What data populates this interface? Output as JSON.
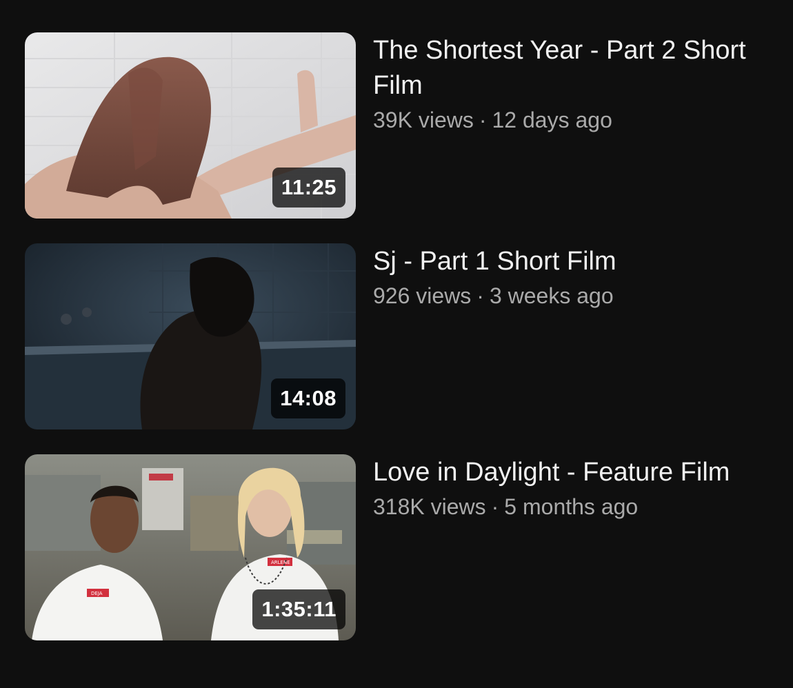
{
  "videos": [
    {
      "title": "The Shortest Year - Part 2 Short Film",
      "views": "39K views",
      "separator": "·",
      "age": "12 days ago",
      "duration": "11:25"
    },
    {
      "title": "Sj - Part 1 Short Film",
      "views": "926 views",
      "separator": "·",
      "age": "3 weeks ago",
      "duration": "14:08"
    },
    {
      "title": "Love in Daylight - Feature Film",
      "views": "318K views",
      "separator": "·",
      "age": "5 months ago",
      "duration": "1:35:11",
      "thumbnail_badges": [
        "DEJA",
        "ARLENE"
      ]
    }
  ]
}
